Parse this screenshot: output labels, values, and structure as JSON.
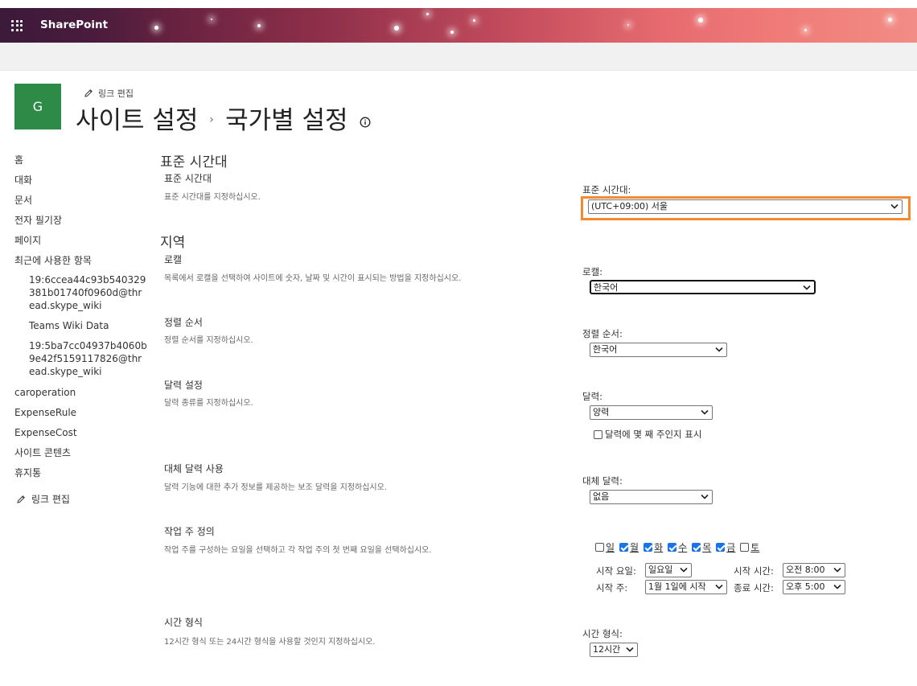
{
  "suite": {
    "brand": "SharePoint"
  },
  "header": {
    "edit_links": "링크 편집",
    "logo_letter": "G",
    "breadcrumb_parent": "사이트 설정",
    "breadcrumb_sep": "›",
    "breadcrumb_current": "국가별 설정"
  },
  "nav": {
    "items": [
      "홈",
      "대화",
      "문서",
      "전자 필기장",
      "페이지",
      "최근에 사용한 항목"
    ],
    "recent": [
      "19:6ccea44c93b540329 381b01740f0960d@thr ead.skype_wiki",
      "Teams Wiki Data",
      "19:5ba7cc04937b4060b 9e42f5159117826@thr ead.skype_wiki"
    ],
    "bottom_items": [
      "caroperation",
      "ExpenseRule",
      "ExpenseCost",
      "사이트 콘텐츠",
      "휴지통"
    ],
    "edit_links": "링크 편집"
  },
  "timezone_section": {
    "heading": "표준 시간대",
    "label": "표준 시간대",
    "description": "표준 시간대를 지정하십시오.",
    "field_label": "표준 시간대:",
    "value": "(UTC+09:00) 서울"
  },
  "region_section": {
    "heading": "지역",
    "locale": {
      "label": "로캘",
      "description": "목록에서 로캘을 선택하여 사이트에 숫자, 날짜 및 시간이 표시되는 방법을 지정하십시오.",
      "field_label": "로캘:",
      "value": "한국어"
    },
    "sort": {
      "label": "정렬 순서",
      "description": "정렬 순서를 지정하십시오.",
      "field_label": "정렬 순서:",
      "value": "한국어"
    },
    "calendar": {
      "label": "달력 설정",
      "description": "달력 종류를 지정하십시오.",
      "field_label": "달력:",
      "value": "양력",
      "week_numbers_label": "달력에 몇 째 주인지 표시",
      "week_numbers_checked": false
    },
    "alt_calendar": {
      "label": "대체 달력 사용",
      "description": "달력 기능에 대한 추가 정보를 제공하는 보조 달력을 지정하십시오.",
      "field_label": "대체 달력:",
      "value": "없음"
    },
    "workweek": {
      "label": "작업 주 정의",
      "description": "작업 주를 구성하는 요일을 선택하고 각 작업 주의 첫 번째 요일을 선택하십시오.",
      "days": [
        {
          "label": "일",
          "checked": false
        },
        {
          "label": "월",
          "checked": true
        },
        {
          "label": "화",
          "checked": true
        },
        {
          "label": "수",
          "checked": true
        },
        {
          "label": "목",
          "checked": true
        },
        {
          "label": "금",
          "checked": true
        },
        {
          "label": "토",
          "checked": false
        }
      ],
      "first_day_label": "시작 요일:",
      "first_day_value": "일요일",
      "start_time_label": "시작 시간:",
      "start_time_value": "오전 8:00",
      "first_week_label": "시작 주:",
      "first_week_value": "1월 1일에 시작",
      "end_time_label": "종료 시간:",
      "end_time_value": "오후 5:00"
    },
    "time_format": {
      "label": "시간 형식",
      "description": "12시간 형식 또는 24시간 형식을 사용할 것인지 지정하십시오.",
      "field_label": "시간 형식:",
      "value": "12시간"
    }
  },
  "colors": {
    "accent_outline": "#f28a2e",
    "logo_bg": "#2e8b47",
    "checkbox_on": "#1a73e8"
  }
}
